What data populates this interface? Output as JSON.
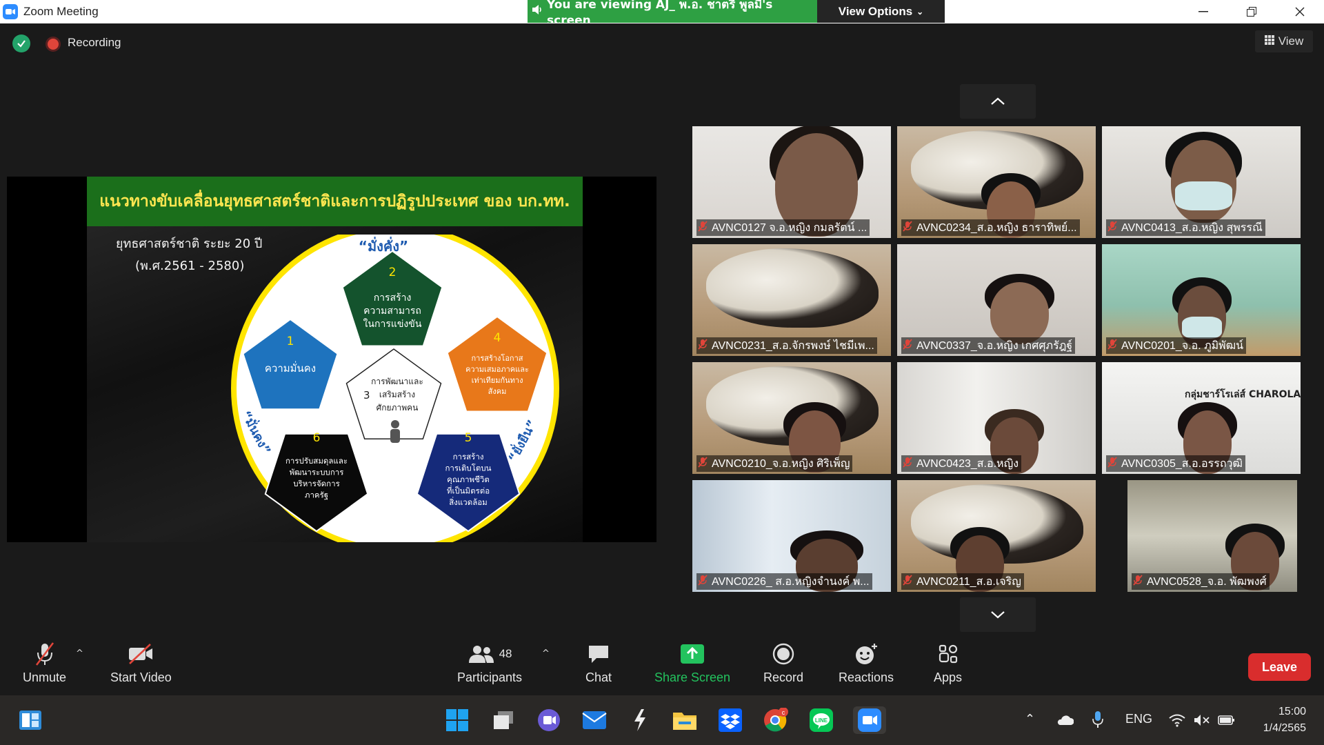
{
  "window": {
    "title": "Zoom Meeting",
    "viewing_banner": "You are viewing AJ_ พ.อ. ชาตรี  พูลมี's screen",
    "view_options": "View Options"
  },
  "meeting": {
    "recording_label": "Recording",
    "view_label": "View"
  },
  "slide": {
    "title": "แนวทางขับเคลื่อนยุทธศาสตร์ชาติและการปฏิรูปประเทศ ของ บก.ทท.",
    "subtitle_line1": "ยุทธศาสตร์ชาติ ระยะ 20 ปี",
    "subtitle_line2": "(พ.ศ.2561 - 2580)",
    "arc_top": "“มั่งคั่ง”",
    "arc_left": "“มั่นคง”",
    "arc_right": "“ยั่งยืน”",
    "center": {
      "number": "3",
      "lines": [
        "การพัฒนาและ",
        "เสริมสร้าง",
        "ศักยภาพคน"
      ]
    },
    "pentagons": [
      {
        "number": "1",
        "lines": [
          "ความมั่นคง"
        ],
        "color": "#1e73be"
      },
      {
        "number": "2",
        "lines": [
          "การสร้าง",
          "ความสามารถ",
          "ในการแข่งขัน"
        ],
        "color": "#14532d"
      },
      {
        "number": "4",
        "lines": [
          "การสร้างโอกาส",
          "ความเสมอภาคและ",
          "เท่าเทียมกันทาง",
          "สังคม"
        ],
        "color": "#e8781a"
      },
      {
        "number": "5",
        "lines": [
          "การสร้าง",
          "การเติบโตบน",
          "คุณภาพชีวิต",
          "ที่เป็นมิตรต่อ",
          "สิ่งแวดล้อม"
        ],
        "color": "#152a7a"
      },
      {
        "number": "6",
        "lines": [
          "การปรับสมดุลและ",
          "พัฒนาระบบการ",
          "บริหารจัดการ",
          "ภาครัฐ"
        ],
        "color": "#0a0a0a"
      }
    ]
  },
  "participants": [
    {
      "name": "AVNC0127 จ.อ.หญิง กมลรัตน์ ..."
    },
    {
      "name": "AVNC0234_ส.อ.หญิง ธาราทิพย์..."
    },
    {
      "name": "AVNC0413_ส.อ.หญิง สุพรรณี"
    },
    {
      "name": "AVNC0231_ส.อ.จักรพงษ์ ไชมีเพ..."
    },
    {
      "name": "AVNC0337_จ.อ.หญิง เกศศุภรัฎฐ์"
    },
    {
      "name": "AVNC0201_จ.อ. ภูมิพัฒน์"
    },
    {
      "name": "AVNC0210_จ.อ.หญิง ศิริเพ็ญ"
    },
    {
      "name": "AVNC0423_ส.อ.หญิง"
    },
    {
      "name": "AVNC0305_ส.อ.อรรถวุฒิ"
    },
    {
      "name": "AVNC0226_ ส.อ.หญิงจำนงค์ พ..."
    },
    {
      "name": "AVNC0211_ส.อ.เจริญ"
    },
    {
      "name": "AVNC0528_จ.อ. พัฒพงศ์"
    }
  ],
  "tile_overlay_texts": {
    "charolais": "กลุ่มชาร์โรเล่ส์ CHAROLAIS"
  },
  "toolbar": {
    "unmute": "Unmute",
    "start_video": "Start Video",
    "participants_label": "Participants",
    "participants_count": "48",
    "chat": "Chat",
    "share_screen": "Share Screen",
    "record": "Record",
    "reactions": "Reactions",
    "apps": "Apps",
    "leave": "Leave"
  },
  "taskbar": {
    "language": "ENG",
    "time": "15:00",
    "date": "1/4/2565"
  },
  "colors": {
    "share_green": "#2ea043",
    "leave_red": "#d92d2d",
    "slide_header_green": "#1b6f1b",
    "slide_title_yellow": "#ffe650"
  }
}
